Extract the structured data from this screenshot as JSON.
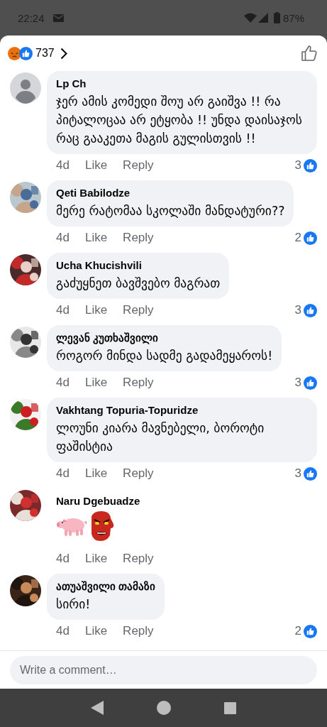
{
  "status_bar": {
    "time": "22:24",
    "battery": "87%"
  },
  "header": {
    "reaction_count": "737"
  },
  "comments": [
    {
      "author": "Lp Ch",
      "avatar": {
        "kind": "default"
      },
      "kind": "text",
      "text": "ჯერ ამის კომედი შოუ არ გაიშვა !! რა პიტალოცაა არ ეტყობა !! უნდა დაისაჯოს რაც გააკეთა მაგის გულისთვის !!",
      "time": "4d",
      "like": "Like",
      "reply": "Reply",
      "likes": "3"
    },
    {
      "author": "Qeti Babilodze",
      "kind": "text",
      "text": "მერე რატომაა სკოლაში მანდატური??",
      "time": "4d",
      "like": "Like",
      "reply": "Reply",
      "likes": "2"
    },
    {
      "author": "Ucha Khucishvili",
      "kind": "text",
      "text": "გაძუყნეთ ბავშვებო მაგრათ",
      "time": "4d",
      "like": "Like",
      "reply": "Reply",
      "likes": "3"
    },
    {
      "author": "ლევან კუთხაშვილი",
      "kind": "text",
      "text": "როგორ მინდა სადმე გადამეყაროს!",
      "time": "4d",
      "like": "Like",
      "reply": "Reply",
      "likes": "3"
    },
    {
      "author": "Vakhtang Topuria-Topuridze",
      "kind": "text",
      "text": "ლოუნი კიარა მავნებელი, ბოროტი ფაშისტია",
      "time": "4d",
      "like": "Like",
      "reply": "Reply",
      "likes": "3"
    },
    {
      "author": "Naru Dgebuadze",
      "kind": "emoji",
      "time": "4d",
      "like": "Like",
      "reply": "Reply"
    },
    {
      "author": "ათუაშვილი თამაზი",
      "kind": "text",
      "text": "სირი!",
      "time": "4d",
      "like": "Like",
      "reply": "Reply",
      "likes": "2"
    }
  ],
  "composer": {
    "placeholder": "Write a comment…"
  }
}
